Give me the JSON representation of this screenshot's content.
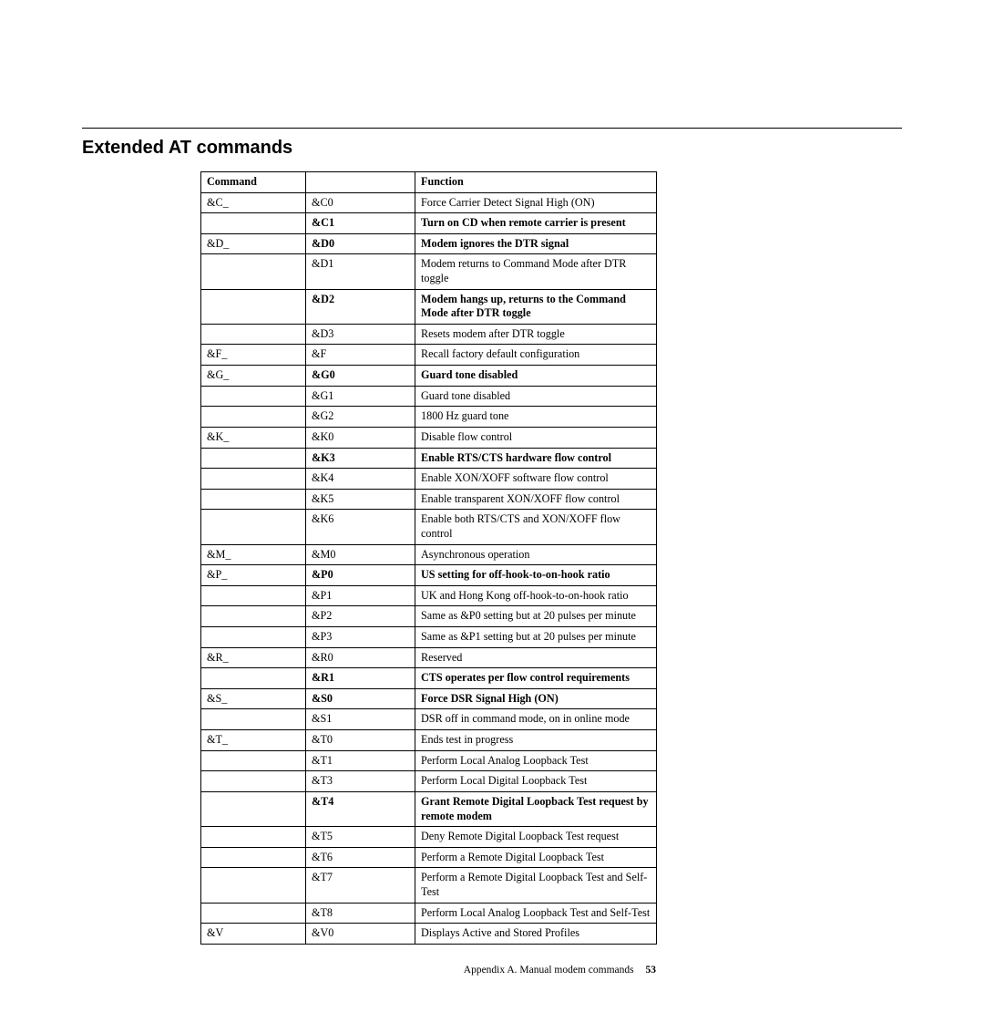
{
  "section_title": "Extended AT commands",
  "headers": {
    "col1": "Command",
    "col2": "",
    "col3": "Function"
  },
  "rows": [
    {
      "c1": "&C_",
      "c2": "&C0",
      "c3": "Force Carrier Detect Signal High (ON)",
      "bold": false
    },
    {
      "c1": "",
      "c2": "&C1",
      "c3": "Turn on CD when remote carrier is present",
      "bold": true
    },
    {
      "c1": "&D_",
      "c2": "&D0",
      "c3": "Modem ignores the DTR signal",
      "bold": true
    },
    {
      "c1": "",
      "c2": "&D1",
      "c3": "Modem returns to Command Mode after DTR toggle",
      "bold": false
    },
    {
      "c1": "",
      "c2": "&D2",
      "c3": "Modem hangs up, returns to the Command Mode after DTR toggle",
      "bold": true
    },
    {
      "c1": "",
      "c2": "&D3",
      "c3": "Resets modem after DTR toggle",
      "bold": false
    },
    {
      "c1": "&F_",
      "c2": "&F",
      "c3": "Recall factory default configuration",
      "bold": false
    },
    {
      "c1": "&G_",
      "c2": "&G0",
      "c3": "Guard tone disabled",
      "bold": true
    },
    {
      "c1": "",
      "c2": "&G1",
      "c3": "Guard tone disabled",
      "bold": false
    },
    {
      "c1": "",
      "c2": "&G2",
      "c3": "1800 Hz guard tone",
      "bold": false
    },
    {
      "c1": "&K_",
      "c2": "&K0",
      "c3": "Disable flow control",
      "bold": false
    },
    {
      "c1": "",
      "c2": "&K3",
      "c3": "Enable RTS/CTS hardware flow control",
      "bold": true
    },
    {
      "c1": "",
      "c2": "&K4",
      "c3": "Enable XON/XOFF software flow control",
      "bold": false
    },
    {
      "c1": "",
      "c2": "&K5",
      "c3": "Enable transparent XON/XOFF flow control",
      "bold": false
    },
    {
      "c1": "",
      "c2": "&K6",
      "c3": "Enable both RTS/CTS and XON/XOFF flow control",
      "bold": false
    },
    {
      "c1": "&M_",
      "c2": "&M0",
      "c3": "Asynchronous operation",
      "bold": false
    },
    {
      "c1": "&P_",
      "c2": "&P0",
      "c3": "US setting for off-hook-to-on-hook ratio",
      "bold": true
    },
    {
      "c1": "",
      "c2": "&P1",
      "c3": "UK and Hong Kong off-hook-to-on-hook ratio",
      "bold": false
    },
    {
      "c1": "",
      "c2": "&P2",
      "c3": "Same as &P0 setting but at 20 pulses per minute",
      "bold": false
    },
    {
      "c1": "",
      "c2": "&P3",
      "c3": "Same as &P1 setting but at 20 pulses per minute",
      "bold": false
    },
    {
      "c1": "&R_",
      "c2": "&R0",
      "c3": "Reserved",
      "bold": false
    },
    {
      "c1": "",
      "c2": "&R1",
      "c3": "CTS operates per flow control requirements",
      "bold": true
    },
    {
      "c1": "&S_",
      "c2": "&S0",
      "c3": "Force DSR Signal High (ON)",
      "bold": true
    },
    {
      "c1": "",
      "c2": "&S1",
      "c3": "DSR off in command mode, on in online mode",
      "bold": false
    },
    {
      "c1": "&T_",
      "c2": "&T0",
      "c3": "Ends test in progress",
      "bold": false
    },
    {
      "c1": "",
      "c2": "&T1",
      "c3": "Perform Local Analog Loopback Test",
      "bold": false
    },
    {
      "c1": "",
      "c2": "&T3",
      "c3": "Perform Local Digital Loopback Test",
      "bold": false
    },
    {
      "c1": "",
      "c2": "&T4",
      "c3": "Grant Remote Digital Loopback Test request by remote modem",
      "bold": true
    },
    {
      "c1": "",
      "c2": "&T5",
      "c3": "Deny Remote Digital Loopback Test request",
      "bold": false
    },
    {
      "c1": "",
      "c2": "&T6",
      "c3": "Perform a Remote Digital Loopback Test",
      "bold": false
    },
    {
      "c1": "",
      "c2": "&T7",
      "c3": "Perform a Remote Digital Loopback Test and Self-Test",
      "bold": false
    },
    {
      "c1": "",
      "c2": "&T8",
      "c3": "Perform Local Analog Loopback Test and Self-Test",
      "bold": false
    },
    {
      "c1": "&V",
      "c2": "&V0",
      "c3": "Displays Active and Stored Profiles",
      "bold": false
    }
  ],
  "footer": {
    "text": "Appendix A. Manual modem commands",
    "page": "53"
  }
}
